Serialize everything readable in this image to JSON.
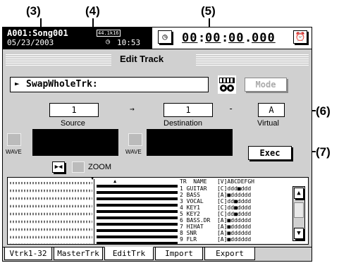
{
  "callouts": {
    "c3": "(3)",
    "c4": "(4)",
    "c5": "(5)",
    "c6": "(6)",
    "c7": "(7)"
  },
  "header": {
    "song": "A001:Song001",
    "date": "05/23/2003",
    "rate_badge": "44.1k16",
    "clock": "10:53",
    "time": {
      "h": "00",
      "m": "00",
      "s": "00",
      "f": "000"
    }
  },
  "title": "Edit Track",
  "command": "SwapWholeTrk:",
  "mode_button": "Mode",
  "source": {
    "value": "1",
    "label": "Source"
  },
  "arrow": "→",
  "destination": {
    "value": "1",
    "label": "Destination"
  },
  "dash": "-",
  "virtual": {
    "value": "A",
    "label": "Virtual"
  },
  "wave_left": "WAVE",
  "wave_right": "WAVE",
  "zoom_label": "ZOOM",
  "exec_button": "Exec",
  "track_list": {
    "header": "TR  NAME   [V]ABCDEFGH",
    "rows": [
      "1 GUITAR   [C]ddd■ddd",
      "2 BASS     [A]■dddddd",
      "3 VOCAL    [C]dd■dddd",
      "4 KEY1     [C]dd■dddd",
      "5 KEY2     [C]dd■dddd",
      "6 BASS.DR  [A]■dddddd",
      "7 HIHAT    [A]■dddddd",
      "8 SNR      [A]■dddddd",
      "9 FLR      [A]■dddddd"
    ]
  },
  "tabs": [
    "Vtrk1-32",
    "MasterTrk",
    "EditTrk",
    "Import",
    "Export"
  ],
  "active_tab": "EditTrk"
}
